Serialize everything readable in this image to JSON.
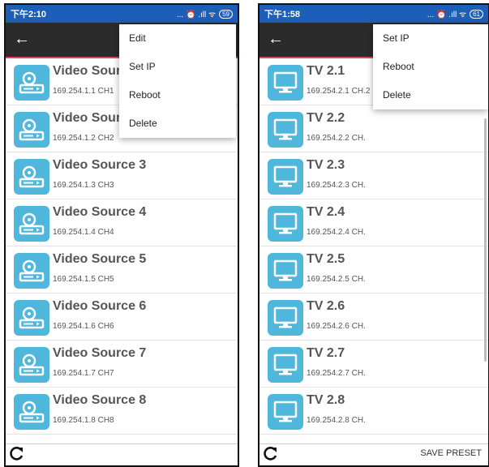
{
  "left": {
    "status": {
      "time": "下午2:10",
      "icons": "... ⏰ .ıll ᯤ",
      "battery": "59"
    },
    "back_glyph": "←",
    "items": [
      {
        "name": "Video Source 1",
        "sub": "169.254.1.1 CH1"
      },
      {
        "name": "Video Source 2",
        "sub": "169.254.1.2 CH2"
      },
      {
        "name": "Video Source 3",
        "sub": "169.254.1.3 CH3"
      },
      {
        "name": "Video Source 4",
        "sub": "169.254.1.4 CH4"
      },
      {
        "name": "Video Source 5",
        "sub": "169.254.1.5 CH5"
      },
      {
        "name": "Video Source 6",
        "sub": "169.254.1.6 CH6"
      },
      {
        "name": "Video Source 7",
        "sub": "169.254.1.7 CH7"
      },
      {
        "name": "Video Source 8",
        "sub": "169.254.1.8 CH8"
      }
    ],
    "menu": [
      "Edit",
      "Set IP",
      "Reboot",
      "Delete"
    ],
    "item_icon": "video-source-icon",
    "refresh_icon": "refresh-icon"
  },
  "right": {
    "status": {
      "time": "下午1:58",
      "icons": "... ⏰ .ıll ᯤ",
      "battery": "61"
    },
    "back_glyph": "←",
    "items": [
      {
        "name": "TV 2.1",
        "sub": "169.254.2.1 CH.2"
      },
      {
        "name": "TV 2.2",
        "sub": "169.254.2.2 CH."
      },
      {
        "name": "TV 2.3",
        "sub": "169.254.2.3 CH."
      },
      {
        "name": "TV 2.4",
        "sub": "169.254.2.4 CH."
      },
      {
        "name": "TV 2.5",
        "sub": "169.254.2.5 CH."
      },
      {
        "name": "TV 2.6",
        "sub": "169.254.2.6 CH."
      },
      {
        "name": "TV 2.7",
        "sub": "169.254.2.7 CH."
      },
      {
        "name": "TV 2.8",
        "sub": "169.254.2.8 CH."
      }
    ],
    "menu": [
      "Set IP",
      "Reboot",
      "Delete"
    ],
    "save_label": "SAVE PRESET",
    "item_icon": "tv-icon",
    "refresh_icon": "refresh-icon"
  },
  "colors": {
    "statusbar": "#1d5fb8",
    "toolbar": "#2b2b2b",
    "accent_line": "#d94a56",
    "tile": "#4fb6dc"
  }
}
